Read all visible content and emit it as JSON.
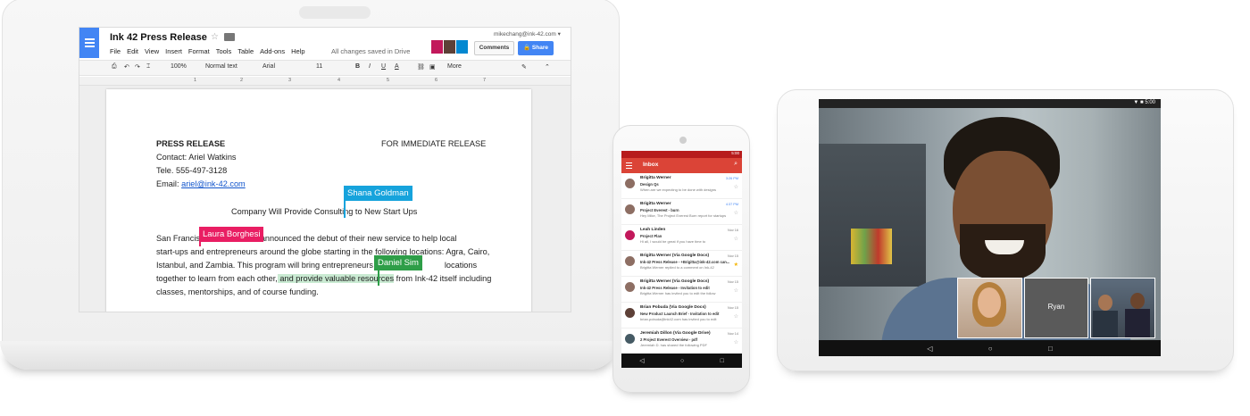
{
  "laptop": {
    "doc_title": "Ink 42 Press Release",
    "user_email": "mikechang@ink-42.com ▾",
    "menu": [
      "File",
      "Edit",
      "View",
      "Insert",
      "Format",
      "Tools",
      "Table",
      "Add-ons",
      "Help"
    ],
    "saved_status": "All changes saved in Drive",
    "comments_label": "Comments",
    "share_label": "Share",
    "toolbar": {
      "zoom": "100%",
      "style": "Normal text",
      "font": "Arial",
      "size": "11",
      "bold": "B",
      "italic": "I",
      "underline": "U",
      "text_color": "A",
      "more": "More"
    },
    "ruler_numbers": [
      "1",
      "1",
      "2",
      "3",
      "4",
      "5",
      "6",
      "7"
    ],
    "document": {
      "heading": "PRESS RELEASE",
      "release_note": "FOR IMMEDIATE RELEASE",
      "contact": "Contact: Ariel Watkins",
      "tele": "Tele. 555-497-3128",
      "email_prefix": "Email: ",
      "email": "ariel@ink-42.com",
      "subtitle": "Company Will Provide Consulting to New Start Ups",
      "para_line1_a": "San Francisco",
      "para_line1_b": "Ink-42 announced the debut of their new service to help local",
      "para_line2": "start-ups and entrepreneurs around the globe starting in the following locations: Agra, Cairo,",
      "para_line3_a": "Istanbul, and Zambia. This program will bring entrepreneurs from",
      "para_line3_b": "locations",
      "para_line4_a": "together to learn from each other,",
      "para_line4_hl": " and provide valuable resources",
      "para_line4_b": " from Ink-42 itself including",
      "para_line5": "classes, mentorships, and of course funding."
    },
    "collaborators": [
      {
        "name": "Shana Goldman",
        "color": "#16a3dc"
      },
      {
        "name": "Laura Borghesi",
        "color": "#e91e63"
      },
      {
        "name": "Daniel Sim",
        "color": "#2e9e48"
      }
    ]
  },
  "phone": {
    "status_time": "5:00",
    "inbox_title": "Inbox",
    "emails": [
      {
        "from": "Brigitta Werner",
        "subject": "Design Qs",
        "snippet": "When are we expecting to be done with designs",
        "date": "3:26 PM",
        "date_highlight": true,
        "starred": false,
        "avatar_color": "#8d6e63"
      },
      {
        "from": "Brigitta Werner",
        "subject": "Project Everest - burn",
        "snippet": "Hey Mike, The Project Everest Burn report for startups",
        "date": "4:37 PM",
        "date_highlight": true,
        "starred": false,
        "avatar_color": "#8d6e63"
      },
      {
        "from": "Leah Linden",
        "subject": "Project Plan",
        "snippet": "Hi all, I would be great if you have time to",
        "date": "Nov 16",
        "date_highlight": false,
        "starred": false,
        "avatar_color": "#c2185b"
      },
      {
        "from": "Brigitta Werner (Via Google Docs)",
        "subject": "Ink-42 Press Release - +Brigitta@ink-42.com can...",
        "snippet": "Brigitta Werner replied to a comment on Ink-42",
        "date": "Nov 15",
        "date_highlight": false,
        "starred": true,
        "avatar_color": "#8d6e63"
      },
      {
        "from": "Brigitta Werner (Via Google Docs)",
        "subject": "Ink-42 Press Release - Invitation to edit",
        "snippet": "Brigitta Werner has invited you to edit the follow",
        "date": "Nov 15",
        "date_highlight": false,
        "starred": false,
        "avatar_color": "#8d6e63"
      },
      {
        "from": "Brian Pobuda (Via Google Docs)",
        "subject": "New Product Launch Brief - Invitation to edit",
        "snippet": "brian.pobuda@ink42.com has invited you to edit",
        "date": "Nov 15",
        "date_highlight": false,
        "starred": false,
        "avatar_color": "#5d4037"
      },
      {
        "from": "Jeremiah Dillon (Via Google Drive)",
        "subject": "2 Project Everest Overview - pdf",
        "snippet": "Jeremiah D. has shared the following PDF",
        "date": "Nov 14",
        "date_highlight": false,
        "starred": false,
        "avatar_color": "#455a64"
      }
    ],
    "nav": [
      "◁",
      "○",
      "□"
    ]
  },
  "tablet": {
    "status_time": "▼ ■ 5:00",
    "participant_label": "Ryan",
    "nav": [
      "◁",
      "○",
      "□"
    ]
  }
}
